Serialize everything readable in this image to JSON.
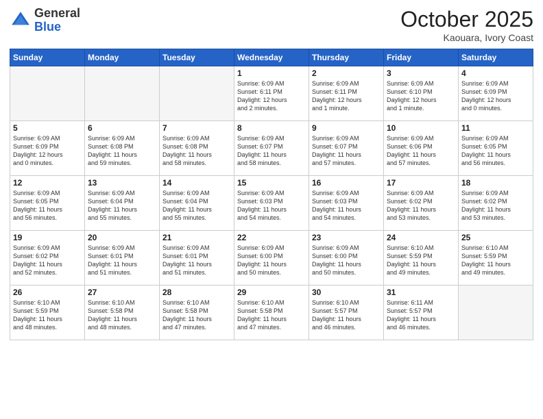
{
  "header": {
    "logo_general": "General",
    "logo_blue": "Blue",
    "month": "October 2025",
    "location": "Kaouara, Ivory Coast"
  },
  "weekdays": [
    "Sunday",
    "Monday",
    "Tuesday",
    "Wednesday",
    "Thursday",
    "Friday",
    "Saturday"
  ],
  "weeks": [
    [
      {
        "day": "",
        "info": ""
      },
      {
        "day": "",
        "info": ""
      },
      {
        "day": "",
        "info": ""
      },
      {
        "day": "1",
        "info": "Sunrise: 6:09 AM\nSunset: 6:11 PM\nDaylight: 12 hours\nand 2 minutes."
      },
      {
        "day": "2",
        "info": "Sunrise: 6:09 AM\nSunset: 6:11 PM\nDaylight: 12 hours\nand 1 minute."
      },
      {
        "day": "3",
        "info": "Sunrise: 6:09 AM\nSunset: 6:10 PM\nDaylight: 12 hours\nand 1 minute."
      },
      {
        "day": "4",
        "info": "Sunrise: 6:09 AM\nSunset: 6:09 PM\nDaylight: 12 hours\nand 0 minutes."
      }
    ],
    [
      {
        "day": "5",
        "info": "Sunrise: 6:09 AM\nSunset: 6:09 PM\nDaylight: 12 hours\nand 0 minutes."
      },
      {
        "day": "6",
        "info": "Sunrise: 6:09 AM\nSunset: 6:08 PM\nDaylight: 11 hours\nand 59 minutes."
      },
      {
        "day": "7",
        "info": "Sunrise: 6:09 AM\nSunset: 6:08 PM\nDaylight: 11 hours\nand 58 minutes."
      },
      {
        "day": "8",
        "info": "Sunrise: 6:09 AM\nSunset: 6:07 PM\nDaylight: 11 hours\nand 58 minutes."
      },
      {
        "day": "9",
        "info": "Sunrise: 6:09 AM\nSunset: 6:07 PM\nDaylight: 11 hours\nand 57 minutes."
      },
      {
        "day": "10",
        "info": "Sunrise: 6:09 AM\nSunset: 6:06 PM\nDaylight: 11 hours\nand 57 minutes."
      },
      {
        "day": "11",
        "info": "Sunrise: 6:09 AM\nSunset: 6:05 PM\nDaylight: 11 hours\nand 56 minutes."
      }
    ],
    [
      {
        "day": "12",
        "info": "Sunrise: 6:09 AM\nSunset: 6:05 PM\nDaylight: 11 hours\nand 56 minutes."
      },
      {
        "day": "13",
        "info": "Sunrise: 6:09 AM\nSunset: 6:04 PM\nDaylight: 11 hours\nand 55 minutes."
      },
      {
        "day": "14",
        "info": "Sunrise: 6:09 AM\nSunset: 6:04 PM\nDaylight: 11 hours\nand 55 minutes."
      },
      {
        "day": "15",
        "info": "Sunrise: 6:09 AM\nSunset: 6:03 PM\nDaylight: 11 hours\nand 54 minutes."
      },
      {
        "day": "16",
        "info": "Sunrise: 6:09 AM\nSunset: 6:03 PM\nDaylight: 11 hours\nand 54 minutes."
      },
      {
        "day": "17",
        "info": "Sunrise: 6:09 AM\nSunset: 6:02 PM\nDaylight: 11 hours\nand 53 minutes."
      },
      {
        "day": "18",
        "info": "Sunrise: 6:09 AM\nSunset: 6:02 PM\nDaylight: 11 hours\nand 53 minutes."
      }
    ],
    [
      {
        "day": "19",
        "info": "Sunrise: 6:09 AM\nSunset: 6:02 PM\nDaylight: 11 hours\nand 52 minutes."
      },
      {
        "day": "20",
        "info": "Sunrise: 6:09 AM\nSunset: 6:01 PM\nDaylight: 11 hours\nand 51 minutes."
      },
      {
        "day": "21",
        "info": "Sunrise: 6:09 AM\nSunset: 6:01 PM\nDaylight: 11 hours\nand 51 minutes."
      },
      {
        "day": "22",
        "info": "Sunrise: 6:09 AM\nSunset: 6:00 PM\nDaylight: 11 hours\nand 50 minutes."
      },
      {
        "day": "23",
        "info": "Sunrise: 6:09 AM\nSunset: 6:00 PM\nDaylight: 11 hours\nand 50 minutes."
      },
      {
        "day": "24",
        "info": "Sunrise: 6:10 AM\nSunset: 5:59 PM\nDaylight: 11 hours\nand 49 minutes."
      },
      {
        "day": "25",
        "info": "Sunrise: 6:10 AM\nSunset: 5:59 PM\nDaylight: 11 hours\nand 49 minutes."
      }
    ],
    [
      {
        "day": "26",
        "info": "Sunrise: 6:10 AM\nSunset: 5:59 PM\nDaylight: 11 hours\nand 48 minutes."
      },
      {
        "day": "27",
        "info": "Sunrise: 6:10 AM\nSunset: 5:58 PM\nDaylight: 11 hours\nand 48 minutes."
      },
      {
        "day": "28",
        "info": "Sunrise: 6:10 AM\nSunset: 5:58 PM\nDaylight: 11 hours\nand 47 minutes."
      },
      {
        "day": "29",
        "info": "Sunrise: 6:10 AM\nSunset: 5:58 PM\nDaylight: 11 hours\nand 47 minutes."
      },
      {
        "day": "30",
        "info": "Sunrise: 6:10 AM\nSunset: 5:57 PM\nDaylight: 11 hours\nand 46 minutes."
      },
      {
        "day": "31",
        "info": "Sunrise: 6:11 AM\nSunset: 5:57 PM\nDaylight: 11 hours\nand 46 minutes."
      },
      {
        "day": "",
        "info": ""
      }
    ]
  ]
}
